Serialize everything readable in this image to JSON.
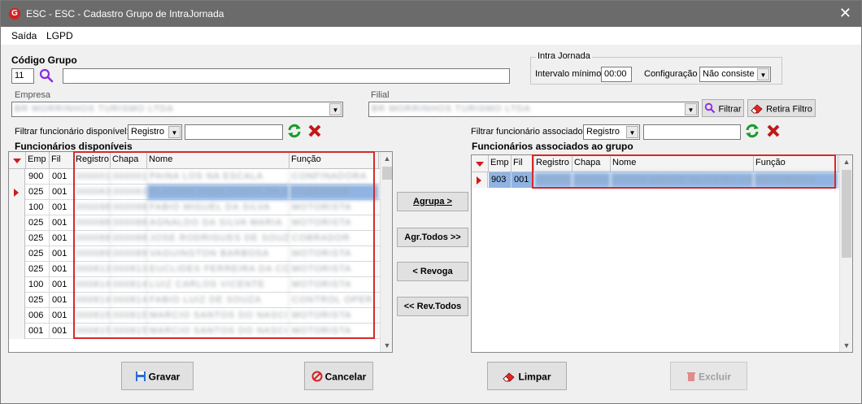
{
  "window": {
    "title": "ESC - ESC - Cadastro Grupo de IntraJornada",
    "close_glyph": "✕",
    "app_glyph": "G"
  },
  "menu": {
    "items": [
      "Saída",
      "LGPD"
    ]
  },
  "codigo_grupo": {
    "label": "Código Grupo",
    "value": "11",
    "description": ""
  },
  "intra_jornada": {
    "legend": "Intra Jornada",
    "intervalo_label": "Intervalo mínimo",
    "intervalo_value": "00:00",
    "config_label": "Configuração",
    "config_value": "Não consiste"
  },
  "empresa": {
    "label": "Empresa",
    "value": "BR MORRINHOS TURISMO LTDA"
  },
  "filial": {
    "label": "Filial",
    "value": "BR MORRINHOS TURISMO LTDA",
    "filtrar_label": "Filtrar",
    "retira_label": "Retira Filtro"
  },
  "left_filter": {
    "label": "Filtrar funcionário disponível:",
    "field_value": "Registro",
    "text_value": ""
  },
  "right_filter": {
    "label": "Filtrar funcionário associado:",
    "field_value": "Registro",
    "text_value": ""
  },
  "left_grid": {
    "caption": "Funcionários disponíveis",
    "columns": [
      "Emp",
      "Fil",
      "Registro",
      "Chapa",
      "Nome",
      "Função"
    ],
    "rows": [
      {
        "emp": "900",
        "fil": "001",
        "registro": "000001",
        "chapa": "000001",
        "nome": "PAINA LOS NA ESCALA",
        "funcao": "CONFINADORA"
      },
      {
        "emp": "025",
        "fil": "001",
        "registro": "000063",
        "chapa": "000063",
        "nome": "PLACIDO YAMA COSTA DA SILVA",
        "funcao": "COBRADOR"
      },
      {
        "emp": "100",
        "fil": "001",
        "registro": "000098",
        "chapa": "000098",
        "nome": "FABIO MIGUEL DA SILVA",
        "funcao": "MOTORISTA"
      },
      {
        "emp": "025",
        "fil": "001",
        "registro": "000088",
        "chapa": "000088",
        "nome": "AGNALDO DA SILVA MARIA",
        "funcao": "MOTORISTA"
      },
      {
        "emp": "025",
        "fil": "001",
        "registro": "000088",
        "chapa": "000088",
        "nome": "JOSE RODRIGUES DE SOUZA",
        "funcao": "COBRADOR"
      },
      {
        "emp": "025",
        "fil": "001",
        "registro": "000089",
        "chapa": "000089",
        "nome": "VAGUINGTON BARBOSA",
        "funcao": "MOTORISTA"
      },
      {
        "emp": "025",
        "fil": "001",
        "registro": "000813",
        "chapa": "000813",
        "nome": "EUCLIDES FERREIRA DA COSTA",
        "funcao": "MOTORISTA"
      },
      {
        "emp": "100",
        "fil": "001",
        "registro": "000814",
        "chapa": "000814",
        "nome": "LUIZ CARLOS VICENTE",
        "funcao": "MOTORISTA"
      },
      {
        "emp": "025",
        "fil": "001",
        "registro": "000814",
        "chapa": "000814",
        "nome": "FABIO LUIZ DE SOUZA",
        "funcao": "CONTROL OPER"
      },
      {
        "emp": "006",
        "fil": "001",
        "registro": "000815",
        "chapa": "000815",
        "nome": "MARCIO SANTOS DO NASCIME",
        "funcao": "MOTORISTA"
      },
      {
        "emp": "001",
        "fil": "001",
        "registro": "000815",
        "chapa": "000815",
        "nome": "MARCIO SANTOS DO NASCIME...",
        "funcao": "MOTORISTA"
      }
    ]
  },
  "right_grid": {
    "caption": "Funcionários associados ao grupo",
    "columns": [
      "Emp",
      "Fil",
      "Registro",
      "Chapa",
      "Nome",
      "Função"
    ],
    "rows": [
      {
        "emp": "903",
        "fil": "001",
        "registro": "000001",
        "chapa": "000001",
        "nome": "CINTIA GRACE OLIVEIRA DA SIL",
        "funcao": "MOTORISTA"
      }
    ]
  },
  "mid_buttons": {
    "agrupa": "Agrupa >",
    "agr_todos": "Agr.Todos >>",
    "revoga": "< Revoga",
    "rev_todos": "<< Rev.Todos"
  },
  "bottom_buttons": {
    "gravar": "Gravar",
    "cancelar": "Cancelar",
    "limpar": "Limpar",
    "excluir": "Excluir"
  },
  "colors": {
    "titlebar": "#6b6b6b",
    "selection": "#8fb4e3",
    "highlight_box": "#d62a2a",
    "indicator": "#cc1b1b"
  }
}
